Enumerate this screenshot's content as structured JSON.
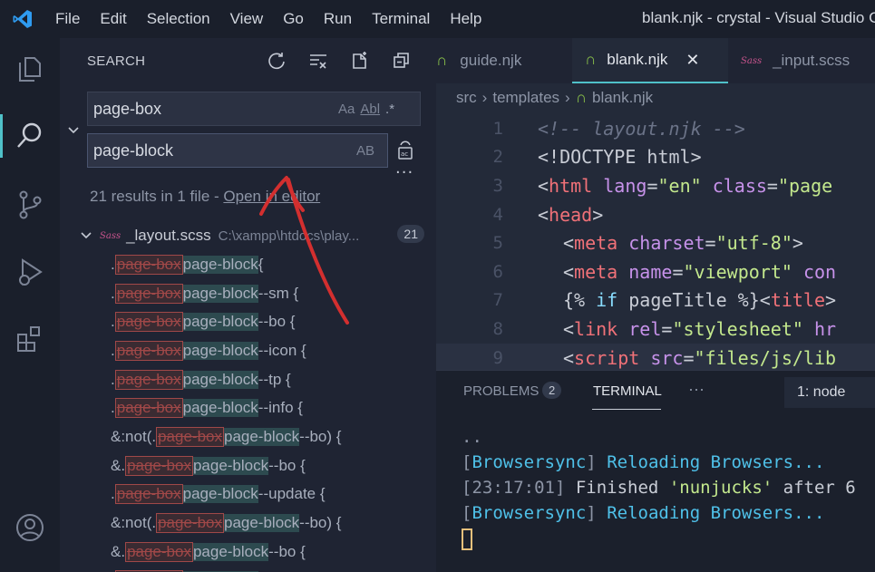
{
  "menu": {
    "items": [
      "File",
      "Edit",
      "Selection",
      "View",
      "Go",
      "Run",
      "Terminal",
      "Help"
    ],
    "window_title": "blank.njk - crystal - Visual Studio C"
  },
  "activity_bar": {
    "icons": [
      "explorer-icon",
      "search-icon",
      "source-control-icon",
      "run-debug-icon",
      "extensions-icon",
      "account-icon"
    ],
    "active": "search-icon"
  },
  "search": {
    "title": "SEARCH",
    "find_value": "page-box",
    "replace_value": "page-block",
    "find_options": [
      "Aa",
      "Abl",
      ".*"
    ],
    "replace_option": "AB",
    "results_summary": "21 results in 1 file - ",
    "open_in_editor": "Open in editor",
    "file": {
      "name": "_layout.scss",
      "path": "C:\\xampp\\htdocs\\play...",
      "count": "21"
    },
    "matches": [
      {
        "before": ".",
        "removed": "page-box",
        "added": "page-block",
        "after": " {",
        "indent": "56"
      },
      {
        "before": ".",
        "removed": "page-box",
        "added": "page-block",
        "after": "--sm {",
        "indent": "56"
      },
      {
        "before": ".",
        "removed": "page-box",
        "added": "page-block",
        "after": "--bo {",
        "indent": "56"
      },
      {
        "before": ".",
        "removed": "page-box",
        "added": "page-block",
        "after": "--icon {",
        "indent": "56"
      },
      {
        "before": ".",
        "removed": "page-box",
        "added": "page-block",
        "after": "--tp {",
        "indent": "56"
      },
      {
        "before": ".",
        "removed": "page-box",
        "added": "page-block",
        "after": "--info {",
        "indent": "56"
      },
      {
        "before": "&:not(.",
        "removed": "page-box",
        "added": "page-block",
        "after": "--bo) {",
        "indent": "56"
      },
      {
        "before": "&.",
        "removed": "page-box",
        "added": "page-block",
        "after": "--bo {",
        "indent": "56"
      },
      {
        "before": ".",
        "removed": "page-box",
        "added": "page-block",
        "after": "--update {",
        "indent": "56"
      },
      {
        "before": "&:not(.",
        "removed": "page-box",
        "added": "page-block",
        "after": "--bo) {",
        "indent": "56"
      },
      {
        "before": "&.",
        "removed": "page-box",
        "added": "page-block",
        "after": "--bo {",
        "indent": "56"
      },
      {
        "before": ".",
        "removed": "page-box",
        "added": "page-block",
        "after": "",
        "indent": "56"
      }
    ]
  },
  "editor": {
    "tabs": [
      {
        "label": "guide.njk",
        "active": false
      },
      {
        "label": "blank.njk",
        "active": true
      },
      {
        "label": "_input.scss",
        "active": false
      }
    ],
    "breadcrumb": [
      "src",
      "templates",
      "blank.njk"
    ],
    "lines": [
      {
        "n": "1",
        "parts": [
          {
            "t": "<!-- layout.njk -->",
            "c": "c-com"
          }
        ],
        "indent": 0
      },
      {
        "n": "2",
        "parts": [
          {
            "t": "<!DOCTYPE html>",
            "c": "c-plain"
          }
        ],
        "indent": 0
      },
      {
        "n": "3",
        "parts": [
          {
            "t": "<",
            "c": "c-plain"
          },
          {
            "t": "html",
            "c": "c-tag"
          },
          {
            "t": " lang",
            "c": "c-attr"
          },
          {
            "t": "=",
            "c": "c-plain"
          },
          {
            "t": "\"en\"",
            "c": "c-str"
          },
          {
            "t": " class",
            "c": "c-attr"
          },
          {
            "t": "=",
            "c": "c-plain"
          },
          {
            "t": "\"page",
            "c": "c-str"
          }
        ],
        "indent": 0
      },
      {
        "n": "4",
        "parts": [
          {
            "t": "<",
            "c": "c-plain"
          },
          {
            "t": "head",
            "c": "c-tag"
          },
          {
            "t": ">",
            "c": "c-plain"
          }
        ],
        "indent": 0
      },
      {
        "n": "5",
        "parts": [
          {
            "t": "<",
            "c": "c-plain"
          },
          {
            "t": "meta",
            "c": "c-tag"
          },
          {
            "t": " charset",
            "c": "c-attr"
          },
          {
            "t": "=",
            "c": "c-plain"
          },
          {
            "t": "\"utf-8\"",
            "c": "c-str"
          },
          {
            "t": ">",
            "c": "c-plain"
          }
        ],
        "indent": 1
      },
      {
        "n": "6",
        "parts": [
          {
            "t": "<",
            "c": "c-plain"
          },
          {
            "t": "meta",
            "c": "c-tag"
          },
          {
            "t": " name",
            "c": "c-attr"
          },
          {
            "t": "=",
            "c": "c-plain"
          },
          {
            "t": "\"viewport\"",
            "c": "c-str"
          },
          {
            "t": " con",
            "c": "c-attr"
          }
        ],
        "indent": 1
      },
      {
        "n": "7",
        "parts": [
          {
            "t": "{% ",
            "c": "c-plain"
          },
          {
            "t": "if",
            "c": "c-kw"
          },
          {
            "t": " pageTitle %}",
            "c": "c-plain"
          },
          {
            "t": "<",
            "c": "c-plain"
          },
          {
            "t": "title",
            "c": "c-tag"
          },
          {
            "t": ">",
            "c": "c-plain"
          }
        ],
        "indent": 1
      },
      {
        "n": "8",
        "parts": [
          {
            "t": "<",
            "c": "c-plain"
          },
          {
            "t": "link",
            "c": "c-tag"
          },
          {
            "t": " rel",
            "c": "c-attr"
          },
          {
            "t": "=",
            "c": "c-plain"
          },
          {
            "t": "\"stylesheet\"",
            "c": "c-str"
          },
          {
            "t": " hr",
            "c": "c-attr"
          }
        ],
        "indent": 1
      },
      {
        "n": "9",
        "parts": [
          {
            "t": "<",
            "c": "c-plain"
          },
          {
            "t": "script",
            "c": "c-tag"
          },
          {
            "t": " src",
            "c": "c-attr"
          },
          {
            "t": "=",
            "c": "c-plain"
          },
          {
            "t": "\"files/js/lib",
            "c": "c-str"
          }
        ],
        "indent": 1
      }
    ]
  },
  "panel": {
    "tabs": [
      "PROBLEMS",
      "TERMINAL",
      "···"
    ],
    "problems_count": "2",
    "terminal_select": "1: node",
    "terminal_lines": [
      [
        {
          "t": "..",
          "c": "t-br"
        }
      ],
      [
        {
          "t": "[",
          "c": "t-br"
        },
        {
          "t": "Browsersync",
          "c": "t-cy"
        },
        {
          "t": "] ",
          "c": "t-br"
        },
        {
          "t": "Reloading Browsers...",
          "c": "t-cy"
        }
      ],
      [
        {
          "t": "[",
          "c": "t-br"
        },
        {
          "t": "23:17:01",
          "c": "t-ts"
        },
        {
          "t": "] ",
          "c": "t-br"
        },
        {
          "t": "Finished ",
          "c": "t-pl"
        },
        {
          "t": "'nunjucks'",
          "c": "t-str"
        },
        {
          "t": " after 6",
          "c": "t-pl"
        }
      ],
      [
        {
          "t": "[",
          "c": "t-br"
        },
        {
          "t": "Browsersync",
          "c": "t-cy"
        },
        {
          "t": "] ",
          "c": "t-br"
        },
        {
          "t": "Reloading Browsers...",
          "c": "t-cy"
        }
      ]
    ]
  },
  "colors": {
    "accent": "#4fc1c9",
    "annotation": "#d32f2f"
  }
}
